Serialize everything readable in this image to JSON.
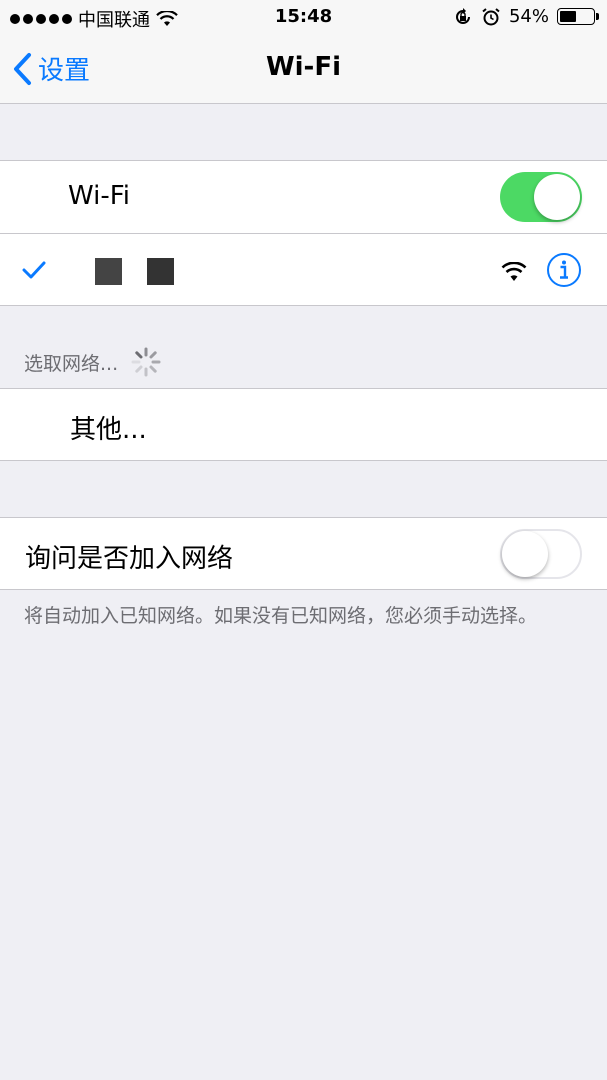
{
  "status_bar": {
    "carrier": "中国联通",
    "time": "15:48",
    "battery_percent": "54%",
    "battery_level": 0.54,
    "signal_icon": "signal-dots",
    "wifi_icon": "wifi-icon",
    "rotation_lock_icon": "rotation-lock-icon",
    "alarm_icon": "alarm-icon"
  },
  "nav": {
    "back_label": "设置",
    "title": "Wi-Fi"
  },
  "wifi_group": {
    "wifi_label": "Wi-Fi",
    "wifi_enabled": true,
    "connected_network_name": "",
    "connected_check_icon": "checkmark-icon",
    "info_icon": "info-icon"
  },
  "networks_section": {
    "header": "选取网络..."
  },
  "other_row": {
    "label": "其他..."
  },
  "ask_group": {
    "label": "询问是否加入网络",
    "enabled": false,
    "footer": "将自动加入已知网络。如果没有已知网络，您必须手动选择。"
  },
  "colors": {
    "accent": "#0a7aff",
    "switch_on": "#4cd964",
    "background": "#efeff4",
    "secondary_text": "#6d6d72"
  }
}
